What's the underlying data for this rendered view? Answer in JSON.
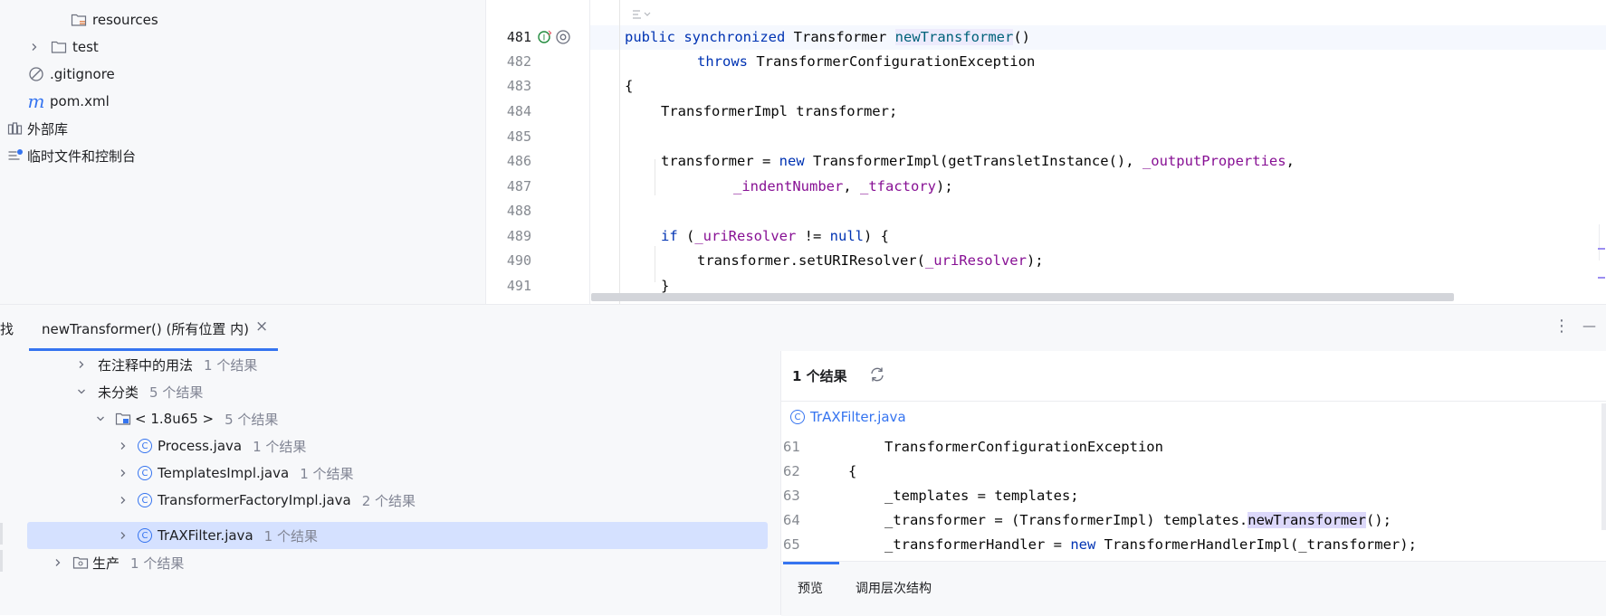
{
  "project_tree": {
    "items": [
      {
        "label": "resources",
        "icon": "folder-resources-icon"
      },
      {
        "label": "test",
        "icon": "folder-icon"
      },
      {
        "label": ".gitignore",
        "icon": "ignore-file-icon"
      },
      {
        "label": "pom.xml",
        "icon": "maven-icon"
      },
      {
        "label": "外部库",
        "icon": "library-icon"
      },
      {
        "label": "临时文件和控制台",
        "icon": "scratches-icon"
      }
    ]
  },
  "editor": {
    "line_numbers": [
      "481",
      "482",
      "483",
      "484",
      "485",
      "486",
      "487",
      "488",
      "489",
      "490",
      "491"
    ],
    "lines": {
      "l481": {
        "kw1": "public",
        "kw2": "synchronized",
        "type": "Transformer",
        "method": "newTransformer",
        "paren": "()"
      },
      "l482": {
        "kw": "throws",
        "rest": "TransformerConfigurationException"
      },
      "l483": "{",
      "l484": "TransformerImpl transformer;",
      "l486": {
        "a": "transformer = ",
        "kw": "new",
        "b": " TransformerImpl(getTransletInstance(), ",
        "fld": "_outputProperties",
        "c": ","
      },
      "l487": {
        "fld1": "_indentNumber",
        "a": ", ",
        "fld2": "_tfactory",
        "b": ");"
      },
      "l489": {
        "kw": "if",
        "a": " (",
        "fld": "_uriResolver",
        "b": " != ",
        "kw2": "null",
        "c": ") {"
      },
      "l490": {
        "a": "transformer.setURIResolver(",
        "fld": "_uriResolver",
        "b": ");"
      },
      "l491": "}"
    }
  },
  "find_panel": {
    "left_tab_partial": "找",
    "active_tab": "newTransformer() (所有位置 内)",
    "close_glyph": "×",
    "more_glyph": "⋮",
    "minimize_glyph": "—",
    "results": [
      {
        "label": "在注释中的用法",
        "count": "1 个结果"
      },
      {
        "label": "未分类",
        "count": "5 个结果"
      },
      {
        "label": "< 1.8u65 >",
        "count": "5 个结果"
      },
      {
        "label": "Process.java",
        "count": "1 个结果"
      },
      {
        "label": "TemplatesImpl.java",
        "count": "1 个结果"
      },
      {
        "label": "TransformerFactoryImpl.java",
        "count": "2 个结果"
      },
      {
        "label": "TrAXFilter.java",
        "count": "1 个结果"
      },
      {
        "label": "生产",
        "count": "1 个结果"
      }
    ],
    "preview": {
      "summary": "1 个结果",
      "file": "TrAXFilter.java",
      "line_numbers": [
        "61",
        "62",
        "63",
        "64",
        "65"
      ],
      "l61": "TransformerConfigurationException",
      "l62": "{",
      "l63": "_templates = templates;",
      "l64": {
        "a": "_transformer = (TransformerImpl) templates.",
        "hl": "newTransformer",
        "b": "();"
      },
      "l65": {
        "a": "_transformerHandler = ",
        "kw": "new",
        "b": " TransformerHandlerImpl(_transformer);"
      },
      "tabs": [
        "预览",
        "调用层次结构"
      ]
    }
  },
  "colors": {
    "accent": "#3574f0",
    "keyword": "#0033b3",
    "field": "#871094",
    "selection": "#d5e1ff",
    "highlight": "#dcd8fa"
  }
}
